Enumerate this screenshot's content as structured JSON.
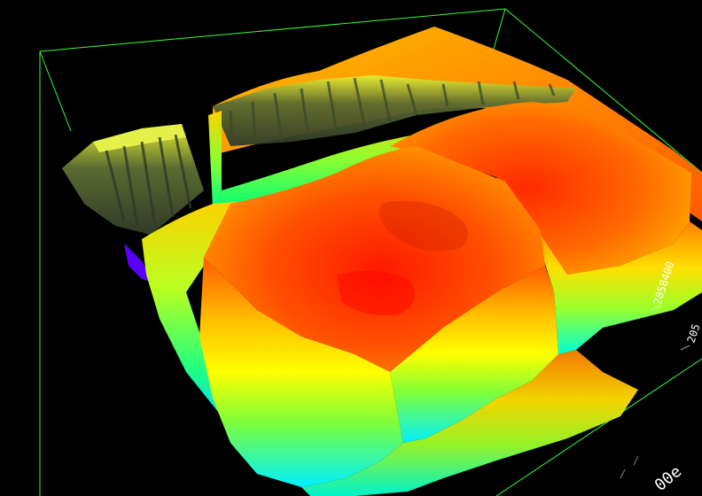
{
  "scene": {
    "background_color": "#000000",
    "bounding_box_color": "#33ff33",
    "colormap": [
      "#0000ff",
      "#00ffff",
      "#00ff00",
      "#ffff00",
      "#ff8000",
      "#ff0000"
    ]
  },
  "axis_labels": {
    "y_tick_1": "2058400",
    "y_tick_2": "205",
    "x_tick_1": "00e"
  }
}
